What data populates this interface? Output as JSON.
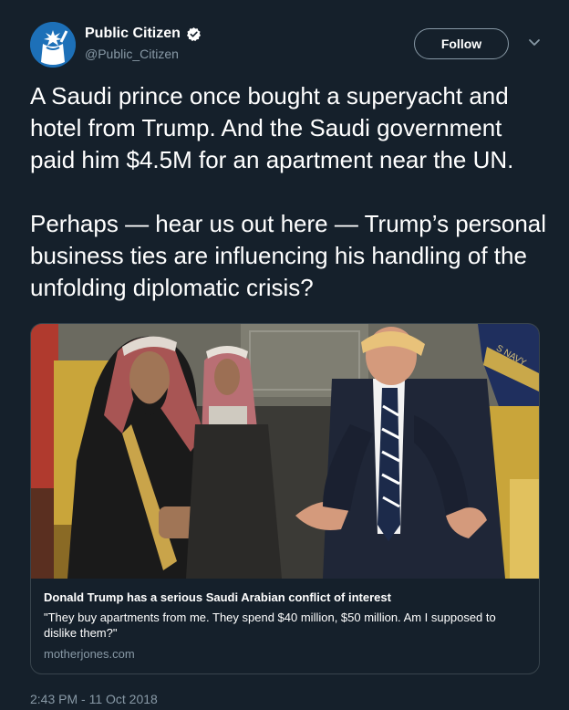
{
  "account": {
    "display_name": "Public Citizen",
    "handle": "@Public_Citizen",
    "verified": true,
    "avatar_icon": "statue-of-liberty-logo"
  },
  "header": {
    "follow_label": "Follow",
    "menu_icon": "chevron-down-icon"
  },
  "tweet": {
    "text": "A Saudi prince once bought a superyacht and hotel from Trump. And the Saudi government paid him $4.5M for an apartment near the UN.\n\nPerhaps — hear us out here — Trump’s personal business ties are influencing his handling of the unfolding diplomatic crisis?"
  },
  "card": {
    "title": "Donald Trump has a serious Saudi Arabian conflict of interest",
    "description": "\"They buy apartments from me. They spend $40 million, $50 million. Am I supposed to dislike them?\"",
    "domain": "motherjones.com",
    "image_flag_text": "S NAVY"
  },
  "timestamp": "2:43 PM - 11 Oct 2018",
  "colors": {
    "background": "#15202b",
    "text": "#ffffff",
    "secondary": "#8899a6",
    "border": "#38444d"
  }
}
